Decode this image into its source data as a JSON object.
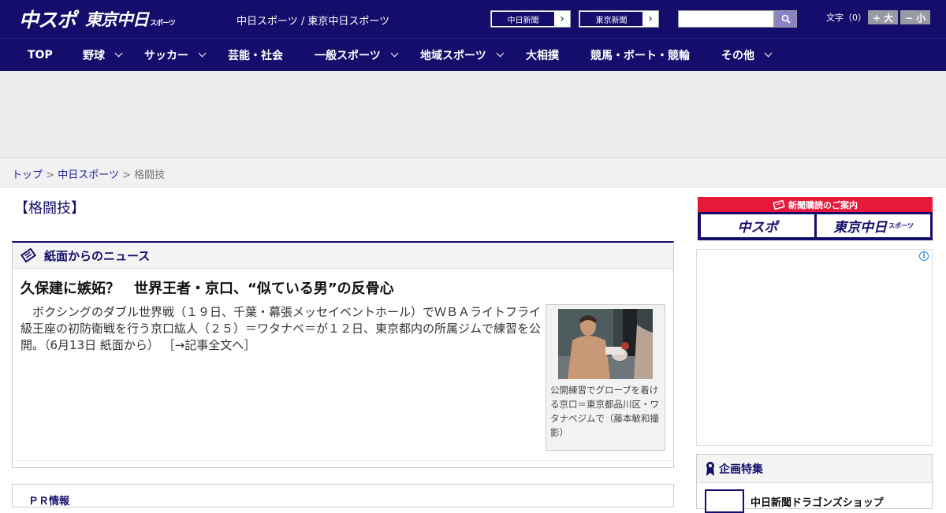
{
  "header": {
    "logo_chuspo": "中スポ",
    "logo_tokyo": "東京中日",
    "logo_tokyo_small": "スポーツ",
    "site_links": "中日スポーツ / 東京中日スポーツ",
    "paper_buttons": [
      "中日新聞",
      "東京新聞"
    ],
    "search_placeholder": "",
    "font_size_label": "文字（0）",
    "font_size_up": "+ 大",
    "font_size_down": "− 小"
  },
  "nav": {
    "items": [
      {
        "label": "TOP",
        "dropdown": false
      },
      {
        "label": "野球",
        "dropdown": true
      },
      {
        "label": "サッカー",
        "dropdown": true
      },
      {
        "label": "芸能・社会",
        "dropdown": false
      },
      {
        "label": "一般スポーツ",
        "dropdown": true
      },
      {
        "label": "地域スポーツ",
        "dropdown": true
      },
      {
        "label": "大相撲",
        "dropdown": false
      },
      {
        "label": "競馬・ボート・競輪",
        "dropdown": false
      },
      {
        "label": "その他",
        "dropdown": true
      }
    ]
  },
  "breadcrumb": {
    "home": "トップ",
    "sep": ">",
    "section": "中日スポーツ",
    "current": "格闘技"
  },
  "main": {
    "section_title": "【格闘技】",
    "panel_title": "紙面からのニュース",
    "headline": "久保建に嫉妬？　世界王者・京口、“似ている男”の反骨心",
    "body": "ボクシングのダブル世界戦（１９日、千葉・幕張メッセイベントホール）でＷＢＡライトフライ級王座の初防衛戦を行う京口紘人（２５）＝ワタナベ＝が１２日、東京都内の所属ジムで練習を公開。（6月13日 紙面から）",
    "more_link": "［→記事全文へ］",
    "photo_caption": "公開練習でグローブを着ける京口＝東京都品川区・ワタナベジムで（藤本敏和撮影）",
    "next_panel_title": "ＰＲ情報"
  },
  "sidebar": {
    "subscribe_title": "新聞購読のご案内",
    "subscribe_buttons": [
      "中スポ",
      "東京中日"
    ],
    "subscribe_button_small": "スポーツ",
    "feature_title": "企画特集",
    "feature_item": "中日新聞ドラゴンズショップ"
  },
  "colors": {
    "brand_navy": "#150d6b",
    "accent_red": "#e8183b"
  }
}
